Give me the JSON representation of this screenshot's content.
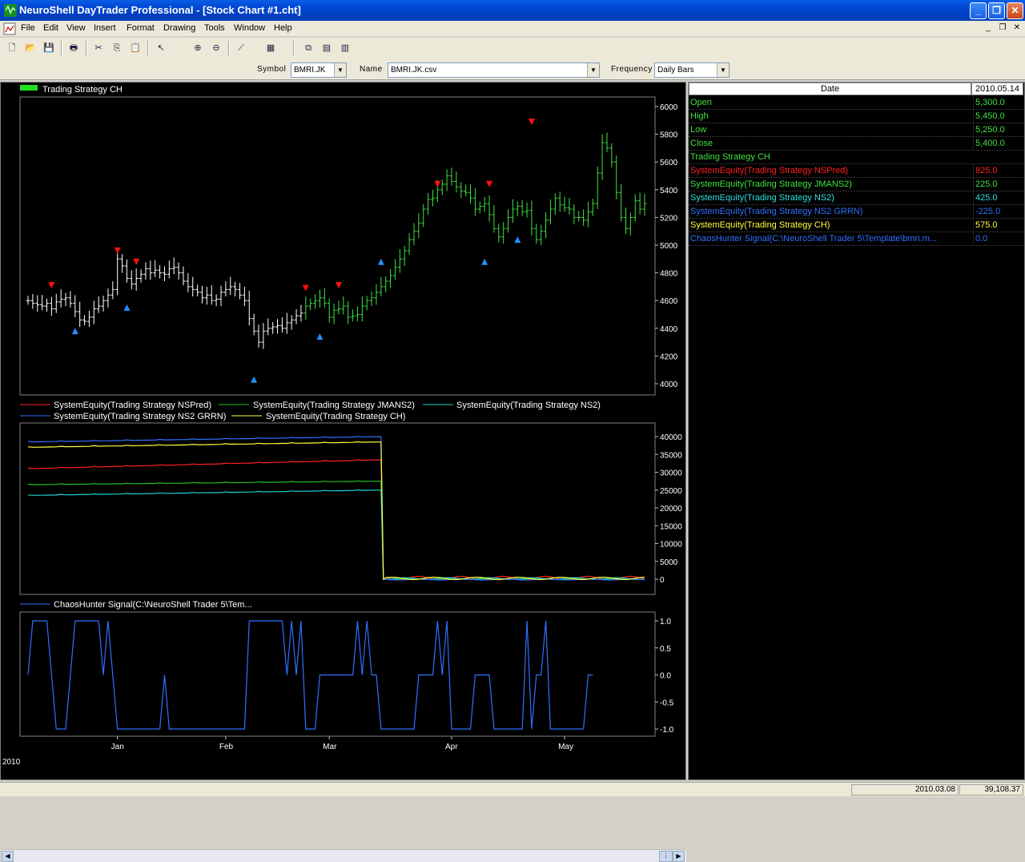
{
  "window": {
    "title": "NeuroShell DayTrader Professional - [Stock Chart #1.cht]",
    "minimize_glyph": "_",
    "restore_glyph": "❐",
    "close_glyph": "✕"
  },
  "menu": {
    "items": [
      "File",
      "Edit",
      "View",
      "Insert",
      "Format",
      "Drawing",
      "Tools",
      "Window",
      "Help"
    ],
    "mdi_controls": [
      "_",
      "❐",
      "✕"
    ]
  },
  "toolbar": {
    "tools": [
      {
        "icon": "new-file-icon",
        "glyph": "🗋"
      },
      {
        "icon": "open-folder-icon",
        "glyph": "📂"
      },
      {
        "icon": "save-icon",
        "glyph": "💾"
      },
      {
        "icon": "print-icon",
        "glyph": "🖶"
      },
      {
        "icon": "cut-icon",
        "glyph": "✂"
      },
      {
        "icon": "copy-icon",
        "glyph": "⎘"
      },
      {
        "icon": "paste-icon",
        "glyph": "📋"
      },
      {
        "icon": "pointer-icon",
        "glyph": "↖"
      },
      {
        "icon": "zoom-in-icon",
        "glyph": "⊕"
      },
      {
        "icon": "zoom-out-icon",
        "glyph": "⊖"
      },
      {
        "icon": "line-tool-icon",
        "glyph": "⟋"
      },
      {
        "icon": "pattern-icon",
        "glyph": "▦"
      },
      {
        "icon": "windows-icon",
        "glyph": "⧉"
      },
      {
        "icon": "chart-window-icon",
        "glyph": "▤"
      },
      {
        "icon": "indicator-icon",
        "glyph": "▥"
      }
    ]
  },
  "selector": {
    "symbol_label": "Symbol",
    "symbol_value": "BMRI.JK",
    "name_label": "Name",
    "name_value": "BMRI.JK.csv",
    "frequency_label": "Frequency",
    "frequency_value": "Daily Bars",
    "dropdown_glyph": "▼"
  },
  "colors": {
    "ns_pred": "#ff2020",
    "jmans2": "#20c020",
    "ns2": "#20d0d0",
    "ns2_grrn": "#3070ff",
    "ch": "#ffff40",
    "price_up": "#40e040",
    "price_bar": "#ffffff",
    "buy_arrow": "#2090ff",
    "sell_arrow": "#ff1010"
  },
  "price_pane": {
    "legend": "Trading Strategy CH"
  },
  "equity_pane": {
    "legends": [
      "SystemEquity(Trading Strategy NSPred)",
      "SystemEquity(Trading Strategy JMANS2)",
      "SystemEquity(Trading Strategy NS2)",
      "SystemEquity(Trading Strategy NS2 GRRN)",
      "SystemEquity(Trading Strategy CH)"
    ]
  },
  "signal_pane": {
    "legend": "ChaosHunter Signal(C:\\NeuroShell Trader 5\\Tem..."
  },
  "chart_data": [
    {
      "type": "bar",
      "pane": "price",
      "ylim": [
        4000,
        6000
      ],
      "yticks": [
        "6000",
        "5800",
        "5600",
        "5400",
        "5200",
        "5000",
        "4800",
        "4600",
        "4400",
        "4200",
        "4000"
      ],
      "xticks": [
        "Jan",
        "Feb",
        "Mar",
        "Apr",
        "May"
      ],
      "year_label": "2010",
      "close": [
        4600,
        4580,
        4570,
        4560,
        4580,
        4540,
        4590,
        4610,
        4620,
        4580,
        4520,
        4460,
        4450,
        4480,
        4540,
        4560,
        4600,
        4640,
        4680,
        4900,
        4850,
        4760,
        4720,
        4760,
        4790,
        4830,
        4800,
        4820,
        4800,
        4790,
        4830,
        4840,
        4800,
        4740,
        4700,
        4680,
        4660,
        4620,
        4640,
        4600,
        4610,
        4660,
        4680,
        4700,
        4680,
        4640,
        4600,
        4470,
        4380,
        4300,
        4380,
        4400,
        4410,
        4420,
        4400,
        4440,
        4460,
        4490,
        4510,
        4560,
        4580,
        4600,
        4620,
        4580,
        4480,
        4530,
        4540,
        4560,
        4480,
        4490,
        4500,
        4560,
        4600,
        4620,
        4660,
        4700,
        4740,
        4780,
        4840,
        4900,
        4960,
        5040,
        5100,
        5160,
        5260,
        5330,
        5340,
        5400,
        5440,
        5500,
        5460,
        5420,
        5390,
        5380,
        5340,
        5260,
        5280,
        5300,
        5220,
        5120,
        5060,
        5120,
        5200,
        5260,
        5280,
        5240,
        5250,
        5120,
        5040,
        5100,
        5180,
        5260,
        5340,
        5290,
        5270,
        5260,
        5200,
        5200,
        5180,
        5240,
        5300,
        5520,
        5740,
        5700,
        5600,
        5380,
        5200,
        5120,
        5200,
        5320,
        5260,
        5300
      ],
      "signal": [
        0,
        1,
        1,
        1,
        1,
        0,
        -1,
        -1,
        -1,
        0,
        1,
        1,
        1,
        1,
        1,
        1,
        0,
        1,
        0,
        -1,
        -1,
        -1,
        -1,
        -1,
        -1,
        -1,
        -1,
        -1,
        -1,
        0,
        -1,
        -1,
        -1,
        -1,
        -1,
        -1,
        -1,
        -1,
        -1,
        -1,
        -1,
        -1,
        -1,
        -1,
        -1,
        -1,
        -1,
        1,
        1,
        1,
        1,
        1,
        1,
        1,
        1,
        0,
        1,
        0,
        1,
        -1,
        -1,
        -1,
        0,
        0,
        0,
        0,
        0,
        0,
        0,
        0,
        1,
        0,
        1,
        0,
        0,
        -1,
        -1,
        -1,
        -1,
        -1,
        -1,
        -1,
        -1,
        0,
        0,
        0,
        0,
        1,
        0,
        1,
        -1,
        -1,
        -1,
        -1,
        -1,
        0,
        0,
        0,
        0,
        -1,
        -1,
        -1,
        -1,
        -1,
        -1,
        -1,
        1,
        -1,
        0,
        0,
        1,
        -1,
        -1,
        -1,
        -1,
        -1,
        -1,
        -1,
        -1,
        0,
        0
      ],
      "buy_markers": [
        [
          10,
          4380
        ],
        [
          21,
          4550
        ],
        [
          48,
          4030
        ],
        [
          62,
          4340
        ],
        [
          75,
          4880
        ],
        [
          97,
          4880
        ],
        [
          104,
          5040
        ]
      ],
      "sell_markers": [
        [
          5,
          4710
        ],
        [
          19,
          4960
        ],
        [
          23,
          4880
        ],
        [
          59,
          4690
        ],
        [
          66,
          4710
        ],
        [
          87,
          5440
        ],
        [
          98,
          5440
        ],
        [
          107,
          5890
        ]
      ]
    },
    {
      "type": "line",
      "pane": "equity",
      "ylim": [
        0,
        40000
      ],
      "yticks": [
        "40000",
        "35000",
        "30000",
        "25000",
        "20000",
        "15000",
        "10000",
        "5000",
        "0"
      ],
      "series": [
        {
          "name": "SystemEquity(Trading Strategy NSPred)",
          "start": 31000,
          "end": 33500,
          "tail": 825
        },
        {
          "name": "SystemEquity(Trading Strategy JMANS2)",
          "start": 26500,
          "end": 27500,
          "tail": 225
        },
        {
          "name": "SystemEquity(Trading Strategy NS2)",
          "start": 23500,
          "end": 25000,
          "tail": 425
        },
        {
          "name": "SystemEquity(Trading Strategy NS2 GRRN)",
          "start": 38500,
          "end": 40000,
          "tail": -225
        },
        {
          "name": "SystemEquity(Trading Strategy CH)",
          "start": 37000,
          "end": 38500,
          "tail": 575
        }
      ],
      "drop_index": 75
    },
    {
      "type": "line",
      "pane": "signal",
      "ylim": [
        -1,
        1
      ],
      "yticks": [
        "1.0",
        "0.5",
        "0.0",
        "-0.5",
        "-1.0"
      ]
    }
  ],
  "data_window": {
    "header_left": "Date",
    "header_right": "2010.05.14",
    "rows": [
      {
        "label": "Open",
        "value": "5,300.0",
        "color": "#40e040"
      },
      {
        "label": "High",
        "value": "5,450.0",
        "color": "#40e040"
      },
      {
        "label": "Low",
        "value": "5,250.0",
        "color": "#40e040"
      },
      {
        "label": "Close",
        "value": "5,400.0",
        "color": "#40e040"
      },
      {
        "label": "Trading Strategy CH",
        "value": "",
        "color": "#40e040"
      },
      {
        "label": "SystemEquity(Trading Strategy NSPred)",
        "value": "825.0",
        "color": "#ff2020"
      },
      {
        "label": "SystemEquity(Trading Strategy JMANS2)",
        "value": "225.0",
        "color": "#40e040"
      },
      {
        "label": "SystemEquity(Trading Strategy NS2)",
        "value": "425.0",
        "color": "#30e0e0"
      },
      {
        "label": "SystemEquity(Trading Strategy NS2 GRRN)",
        "value": "-225.0",
        "color": "#3070ff"
      },
      {
        "label": "SystemEquity(Trading Strategy CH)",
        "value": "575.0",
        "color": "#ffff40"
      },
      {
        "label": "ChaosHunter Signal(C:\\NeuroShell Trader 5\\Template\\bmri.m...",
        "value": "0.0",
        "color": "#3070ff"
      }
    ]
  },
  "status": {
    "date": "2010.03.08",
    "value": "39,108.37"
  }
}
